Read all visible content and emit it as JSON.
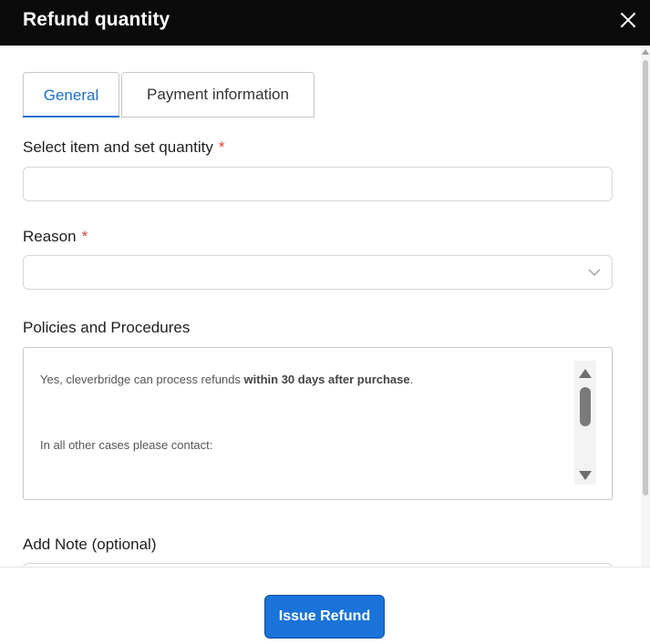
{
  "header": {
    "title": "Refund quantity",
    "close_icon": "close-icon"
  },
  "tabs": [
    {
      "label": "General",
      "active": true
    },
    {
      "label": "Payment information",
      "active": false
    }
  ],
  "form": {
    "item_label": "Select item and set quantity",
    "item_required_mark": "*",
    "item_value": "",
    "reason_label": "Reason",
    "reason_required_mark": "*",
    "reason_value": "",
    "policies_label": "Policies and Procedures",
    "policy": {
      "line1_prefix": "Yes, cleverbridge can process refunds ",
      "line1_bold": "within 30 days after purchase",
      "line1_suffix": ".",
      "line2": "In all other cases please contact:"
    },
    "note_label": "Add Note (optional)"
  },
  "footer": {
    "issue_button_label": "Issue Refund"
  },
  "colors": {
    "header_bg": "#0b0b0b",
    "accent": "#1a6fcf",
    "required": "#e0403a",
    "button_bg": "#1a73d9"
  }
}
